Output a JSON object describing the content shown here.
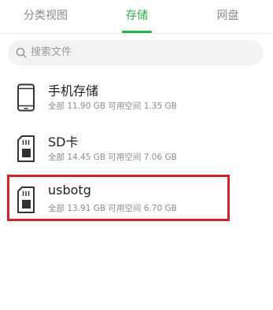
{
  "tabs": [
    {
      "label": "分类视图",
      "active": false
    },
    {
      "label": "存储",
      "active": true
    },
    {
      "label": "网盘",
      "active": false
    }
  ],
  "search": {
    "placeholder": "搜索文件",
    "icon": "search-icon"
  },
  "storage_items": [
    {
      "name": "手机存储",
      "icon": "phone-icon",
      "detail": "全部 11.90 GB 可用空间 1.35 GB"
    },
    {
      "name": "SD卡",
      "icon": "sd-card-icon",
      "detail": "全部 14.45 GB 可用空间 7.06 GB"
    },
    {
      "name": "usbotg",
      "icon": "sd-card-icon",
      "detail": "全部 13.91 GB 可用空间 6.70 GB",
      "highlighted": true
    }
  ],
  "colors": {
    "accent": "#2bb14a",
    "highlight": "#d6202a"
  }
}
